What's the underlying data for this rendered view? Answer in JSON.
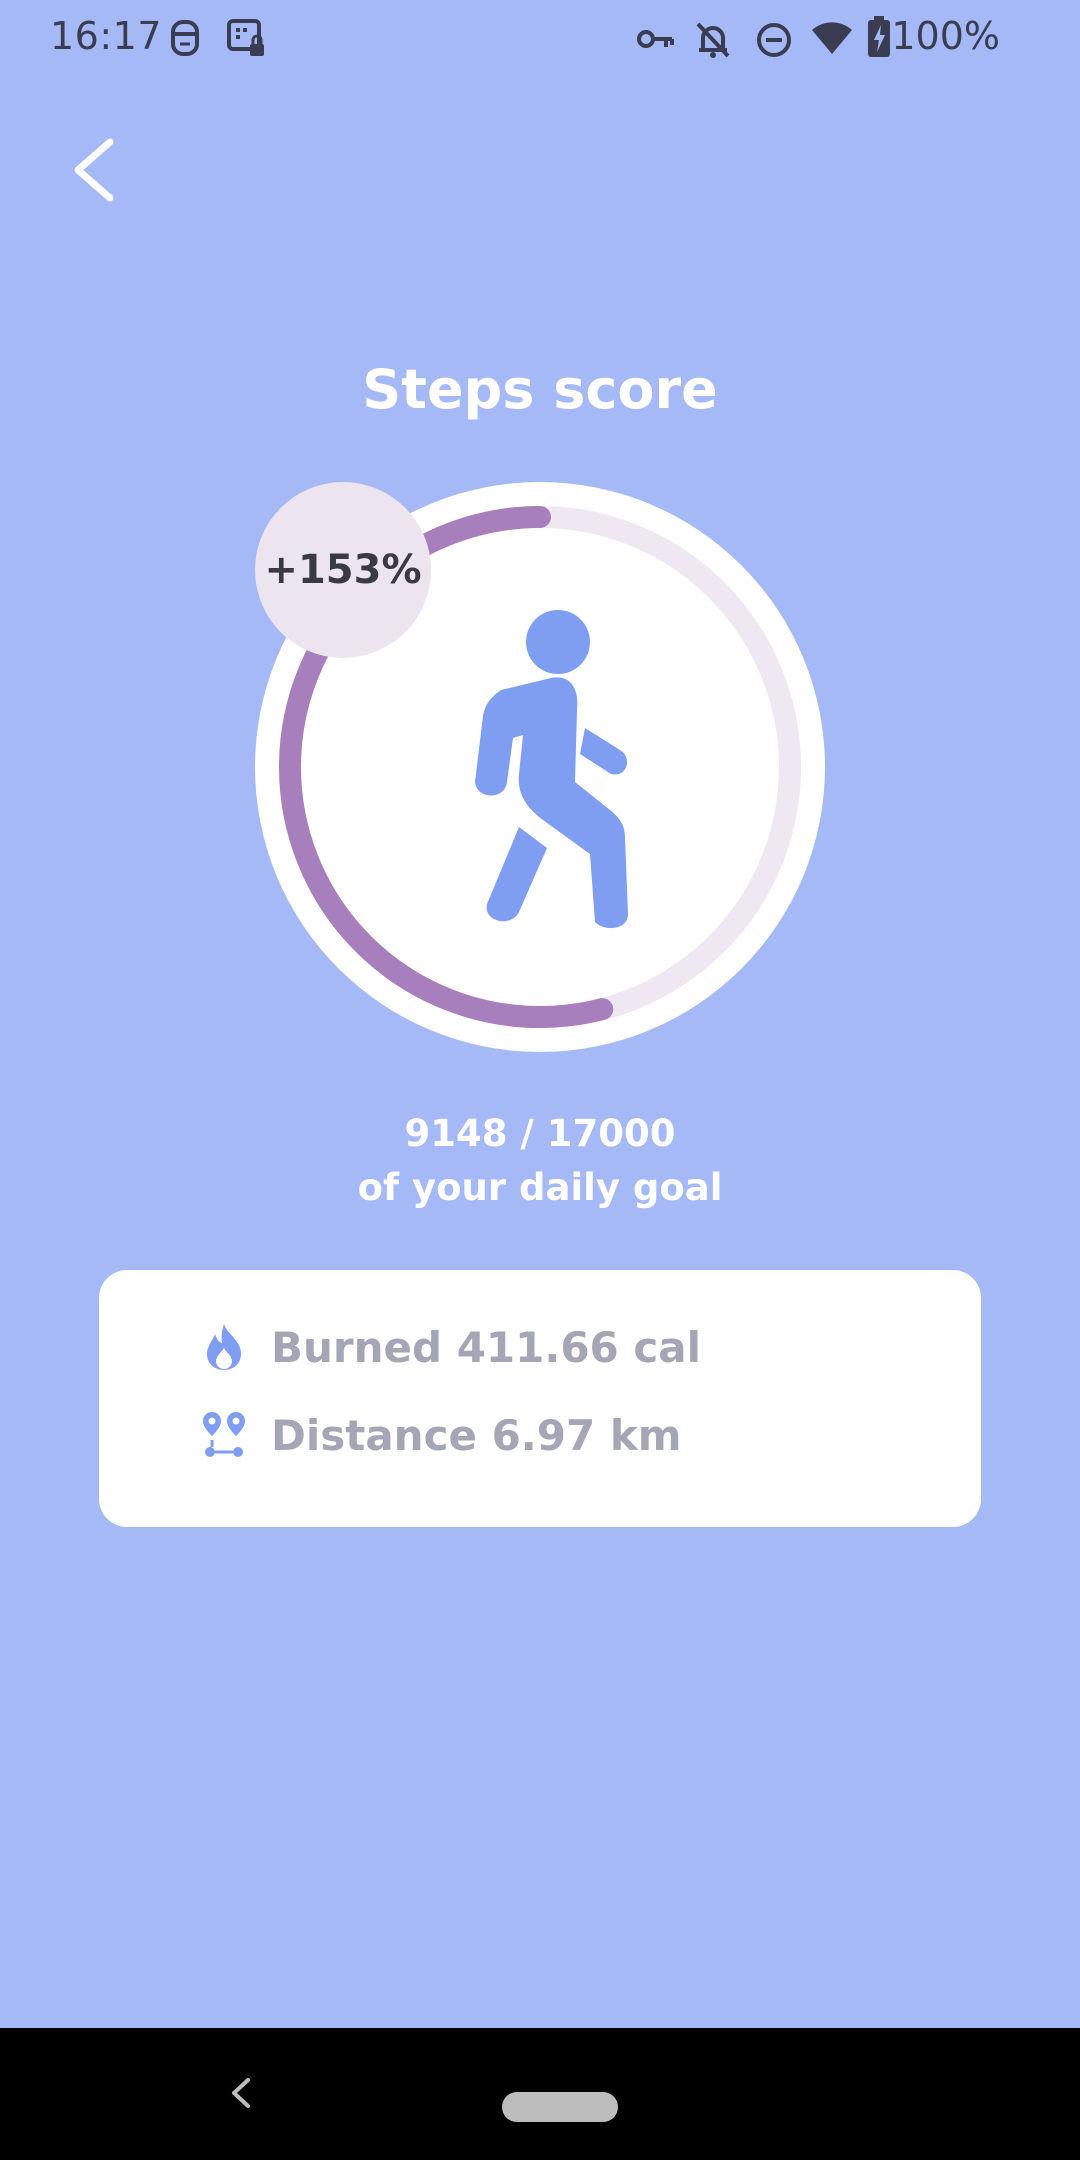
{
  "status_bar": {
    "time": "16:17",
    "battery": "100%",
    "icons": [
      "face-icon",
      "shield-lock-icon",
      "key-icon",
      "bell-off-icon",
      "dnd-icon",
      "wifi-icon",
      "battery-charging-icon"
    ]
  },
  "header": {
    "back_icon": "chevron-left-icon",
    "title": "Steps score"
  },
  "progress": {
    "badge": "+153%",
    "fraction": 0.54,
    "track_color": "#efe8f2",
    "fill_color": "#a77fbc",
    "icon": "walking-person-icon",
    "icon_color": "#7f9ef2"
  },
  "goal": {
    "count": "9148 / 17000",
    "caption": "of your daily goal"
  },
  "stats": [
    {
      "icon": "flame-icon",
      "label": "Burned 411.66 cal"
    },
    {
      "icon": "route-pins-icon",
      "label": "Distance 6.97 km"
    }
  ],
  "colors": {
    "background": "#a5b9f6",
    "card": "#ffffff",
    "stat_text": "#a4a6b5"
  }
}
